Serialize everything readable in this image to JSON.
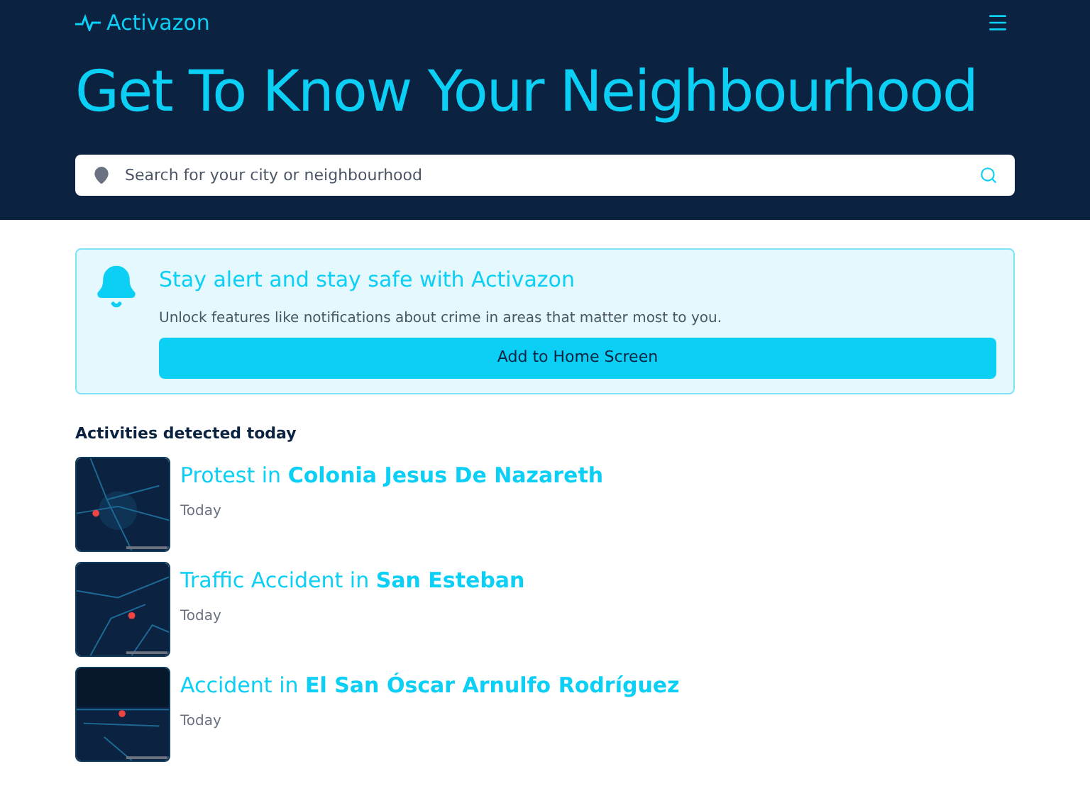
{
  "header": {
    "logo": "Activazon",
    "title": "Get To Know Your Neighbourhood",
    "search": {
      "placeholder": "Search for your city or neighbourhood"
    }
  },
  "alert": {
    "title": "Stay alert and stay safe with Activazon",
    "text": "Unlock features like notifications about crime in areas that matter most to you.",
    "button": "Add to Home Screen"
  },
  "activities": {
    "heading": "Activities detected today",
    "items": [
      {
        "title": "Protest in **Colonia Jesus De Nazareth**",
        "time": "Today"
      },
      {
        "title": "Traffic Accident in **San Esteban**",
        "time": "Today"
      },
      {
        "title": "Accident in **El San Óscar Arnulfo Rodríguez**",
        "time": "Today"
      }
    ]
  }
}
